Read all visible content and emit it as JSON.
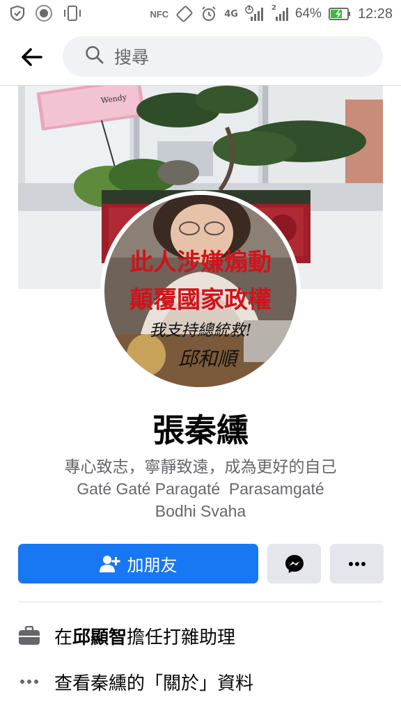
{
  "status_bar": {
    "nfc_label": "NFC",
    "network_label": "4G",
    "sim1_label": "1",
    "sim2_label": "2",
    "battery": "64%",
    "time": "12:28"
  },
  "header": {
    "search_placeholder": "搜尋"
  },
  "profile": {
    "name": "張秦纁",
    "bio_lines": [
      "專心致志，寧靜致遠，成為更好的自己",
      "Gaté Gaté Paragaté  Parasamgaté",
      "Bodhi Svaha"
    ],
    "cover_card_text": "Wendy",
    "avatar_overlay_red": [
      "此人涉嫌煽動",
      "顛覆國家政權"
    ],
    "avatar_overlay_black": [
      "我支持總統救!",
      "邱和順"
    ]
  },
  "actions": {
    "add_friend_label": "加朋友"
  },
  "info": {
    "work_prefix": "在",
    "work_name": "邱顯智",
    "work_suffix": "擔任打雜助理",
    "about_label": "查看秦纁的「關於」資料"
  },
  "colors": {
    "primary": "#1877f2",
    "button_gray": "#e4e6eb",
    "text_secondary": "#65676b"
  }
}
